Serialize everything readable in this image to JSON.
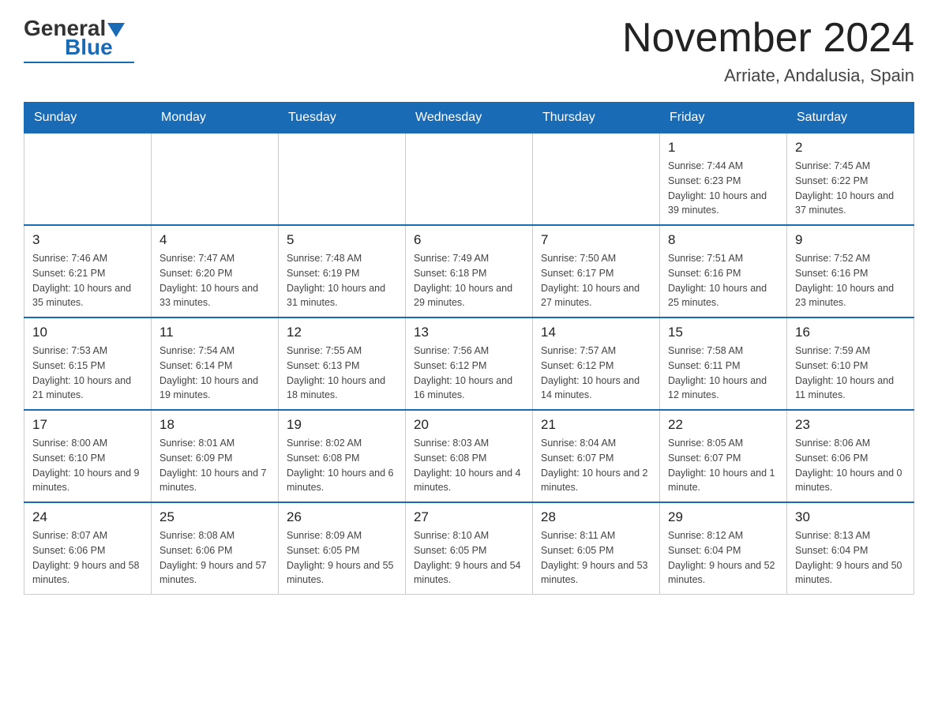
{
  "header": {
    "logo_general": "General",
    "logo_blue": "Blue",
    "title": "November 2024",
    "subtitle": "Arriate, Andalusia, Spain"
  },
  "weekdays": [
    "Sunday",
    "Monday",
    "Tuesday",
    "Wednesday",
    "Thursday",
    "Friday",
    "Saturday"
  ],
  "weeks": [
    [
      {
        "day": "",
        "sunrise": "",
        "sunset": "",
        "daylight": ""
      },
      {
        "day": "",
        "sunrise": "",
        "sunset": "",
        "daylight": ""
      },
      {
        "day": "",
        "sunrise": "",
        "sunset": "",
        "daylight": ""
      },
      {
        "day": "",
        "sunrise": "",
        "sunset": "",
        "daylight": ""
      },
      {
        "day": "",
        "sunrise": "",
        "sunset": "",
        "daylight": ""
      },
      {
        "day": "1",
        "sunrise": "Sunrise: 7:44 AM",
        "sunset": "Sunset: 6:23 PM",
        "daylight": "Daylight: 10 hours and 39 minutes."
      },
      {
        "day": "2",
        "sunrise": "Sunrise: 7:45 AM",
        "sunset": "Sunset: 6:22 PM",
        "daylight": "Daylight: 10 hours and 37 minutes."
      }
    ],
    [
      {
        "day": "3",
        "sunrise": "Sunrise: 7:46 AM",
        "sunset": "Sunset: 6:21 PM",
        "daylight": "Daylight: 10 hours and 35 minutes."
      },
      {
        "day": "4",
        "sunrise": "Sunrise: 7:47 AM",
        "sunset": "Sunset: 6:20 PM",
        "daylight": "Daylight: 10 hours and 33 minutes."
      },
      {
        "day": "5",
        "sunrise": "Sunrise: 7:48 AM",
        "sunset": "Sunset: 6:19 PM",
        "daylight": "Daylight: 10 hours and 31 minutes."
      },
      {
        "day": "6",
        "sunrise": "Sunrise: 7:49 AM",
        "sunset": "Sunset: 6:18 PM",
        "daylight": "Daylight: 10 hours and 29 minutes."
      },
      {
        "day": "7",
        "sunrise": "Sunrise: 7:50 AM",
        "sunset": "Sunset: 6:17 PM",
        "daylight": "Daylight: 10 hours and 27 minutes."
      },
      {
        "day": "8",
        "sunrise": "Sunrise: 7:51 AM",
        "sunset": "Sunset: 6:16 PM",
        "daylight": "Daylight: 10 hours and 25 minutes."
      },
      {
        "day": "9",
        "sunrise": "Sunrise: 7:52 AM",
        "sunset": "Sunset: 6:16 PM",
        "daylight": "Daylight: 10 hours and 23 minutes."
      }
    ],
    [
      {
        "day": "10",
        "sunrise": "Sunrise: 7:53 AM",
        "sunset": "Sunset: 6:15 PM",
        "daylight": "Daylight: 10 hours and 21 minutes."
      },
      {
        "day": "11",
        "sunrise": "Sunrise: 7:54 AM",
        "sunset": "Sunset: 6:14 PM",
        "daylight": "Daylight: 10 hours and 19 minutes."
      },
      {
        "day": "12",
        "sunrise": "Sunrise: 7:55 AM",
        "sunset": "Sunset: 6:13 PM",
        "daylight": "Daylight: 10 hours and 18 minutes."
      },
      {
        "day": "13",
        "sunrise": "Sunrise: 7:56 AM",
        "sunset": "Sunset: 6:12 PM",
        "daylight": "Daylight: 10 hours and 16 minutes."
      },
      {
        "day": "14",
        "sunrise": "Sunrise: 7:57 AM",
        "sunset": "Sunset: 6:12 PM",
        "daylight": "Daylight: 10 hours and 14 minutes."
      },
      {
        "day": "15",
        "sunrise": "Sunrise: 7:58 AM",
        "sunset": "Sunset: 6:11 PM",
        "daylight": "Daylight: 10 hours and 12 minutes."
      },
      {
        "day": "16",
        "sunrise": "Sunrise: 7:59 AM",
        "sunset": "Sunset: 6:10 PM",
        "daylight": "Daylight: 10 hours and 11 minutes."
      }
    ],
    [
      {
        "day": "17",
        "sunrise": "Sunrise: 8:00 AM",
        "sunset": "Sunset: 6:10 PM",
        "daylight": "Daylight: 10 hours and 9 minutes."
      },
      {
        "day": "18",
        "sunrise": "Sunrise: 8:01 AM",
        "sunset": "Sunset: 6:09 PM",
        "daylight": "Daylight: 10 hours and 7 minutes."
      },
      {
        "day": "19",
        "sunrise": "Sunrise: 8:02 AM",
        "sunset": "Sunset: 6:08 PM",
        "daylight": "Daylight: 10 hours and 6 minutes."
      },
      {
        "day": "20",
        "sunrise": "Sunrise: 8:03 AM",
        "sunset": "Sunset: 6:08 PM",
        "daylight": "Daylight: 10 hours and 4 minutes."
      },
      {
        "day": "21",
        "sunrise": "Sunrise: 8:04 AM",
        "sunset": "Sunset: 6:07 PM",
        "daylight": "Daylight: 10 hours and 2 minutes."
      },
      {
        "day": "22",
        "sunrise": "Sunrise: 8:05 AM",
        "sunset": "Sunset: 6:07 PM",
        "daylight": "Daylight: 10 hours and 1 minute."
      },
      {
        "day": "23",
        "sunrise": "Sunrise: 8:06 AM",
        "sunset": "Sunset: 6:06 PM",
        "daylight": "Daylight: 10 hours and 0 minutes."
      }
    ],
    [
      {
        "day": "24",
        "sunrise": "Sunrise: 8:07 AM",
        "sunset": "Sunset: 6:06 PM",
        "daylight": "Daylight: 9 hours and 58 minutes."
      },
      {
        "day": "25",
        "sunrise": "Sunrise: 8:08 AM",
        "sunset": "Sunset: 6:06 PM",
        "daylight": "Daylight: 9 hours and 57 minutes."
      },
      {
        "day": "26",
        "sunrise": "Sunrise: 8:09 AM",
        "sunset": "Sunset: 6:05 PM",
        "daylight": "Daylight: 9 hours and 55 minutes."
      },
      {
        "day": "27",
        "sunrise": "Sunrise: 8:10 AM",
        "sunset": "Sunset: 6:05 PM",
        "daylight": "Daylight: 9 hours and 54 minutes."
      },
      {
        "day": "28",
        "sunrise": "Sunrise: 8:11 AM",
        "sunset": "Sunset: 6:05 PM",
        "daylight": "Daylight: 9 hours and 53 minutes."
      },
      {
        "day": "29",
        "sunrise": "Sunrise: 8:12 AM",
        "sunset": "Sunset: 6:04 PM",
        "daylight": "Daylight: 9 hours and 52 minutes."
      },
      {
        "day": "30",
        "sunrise": "Sunrise: 8:13 AM",
        "sunset": "Sunset: 6:04 PM",
        "daylight": "Daylight: 9 hours and 50 minutes."
      }
    ]
  ]
}
